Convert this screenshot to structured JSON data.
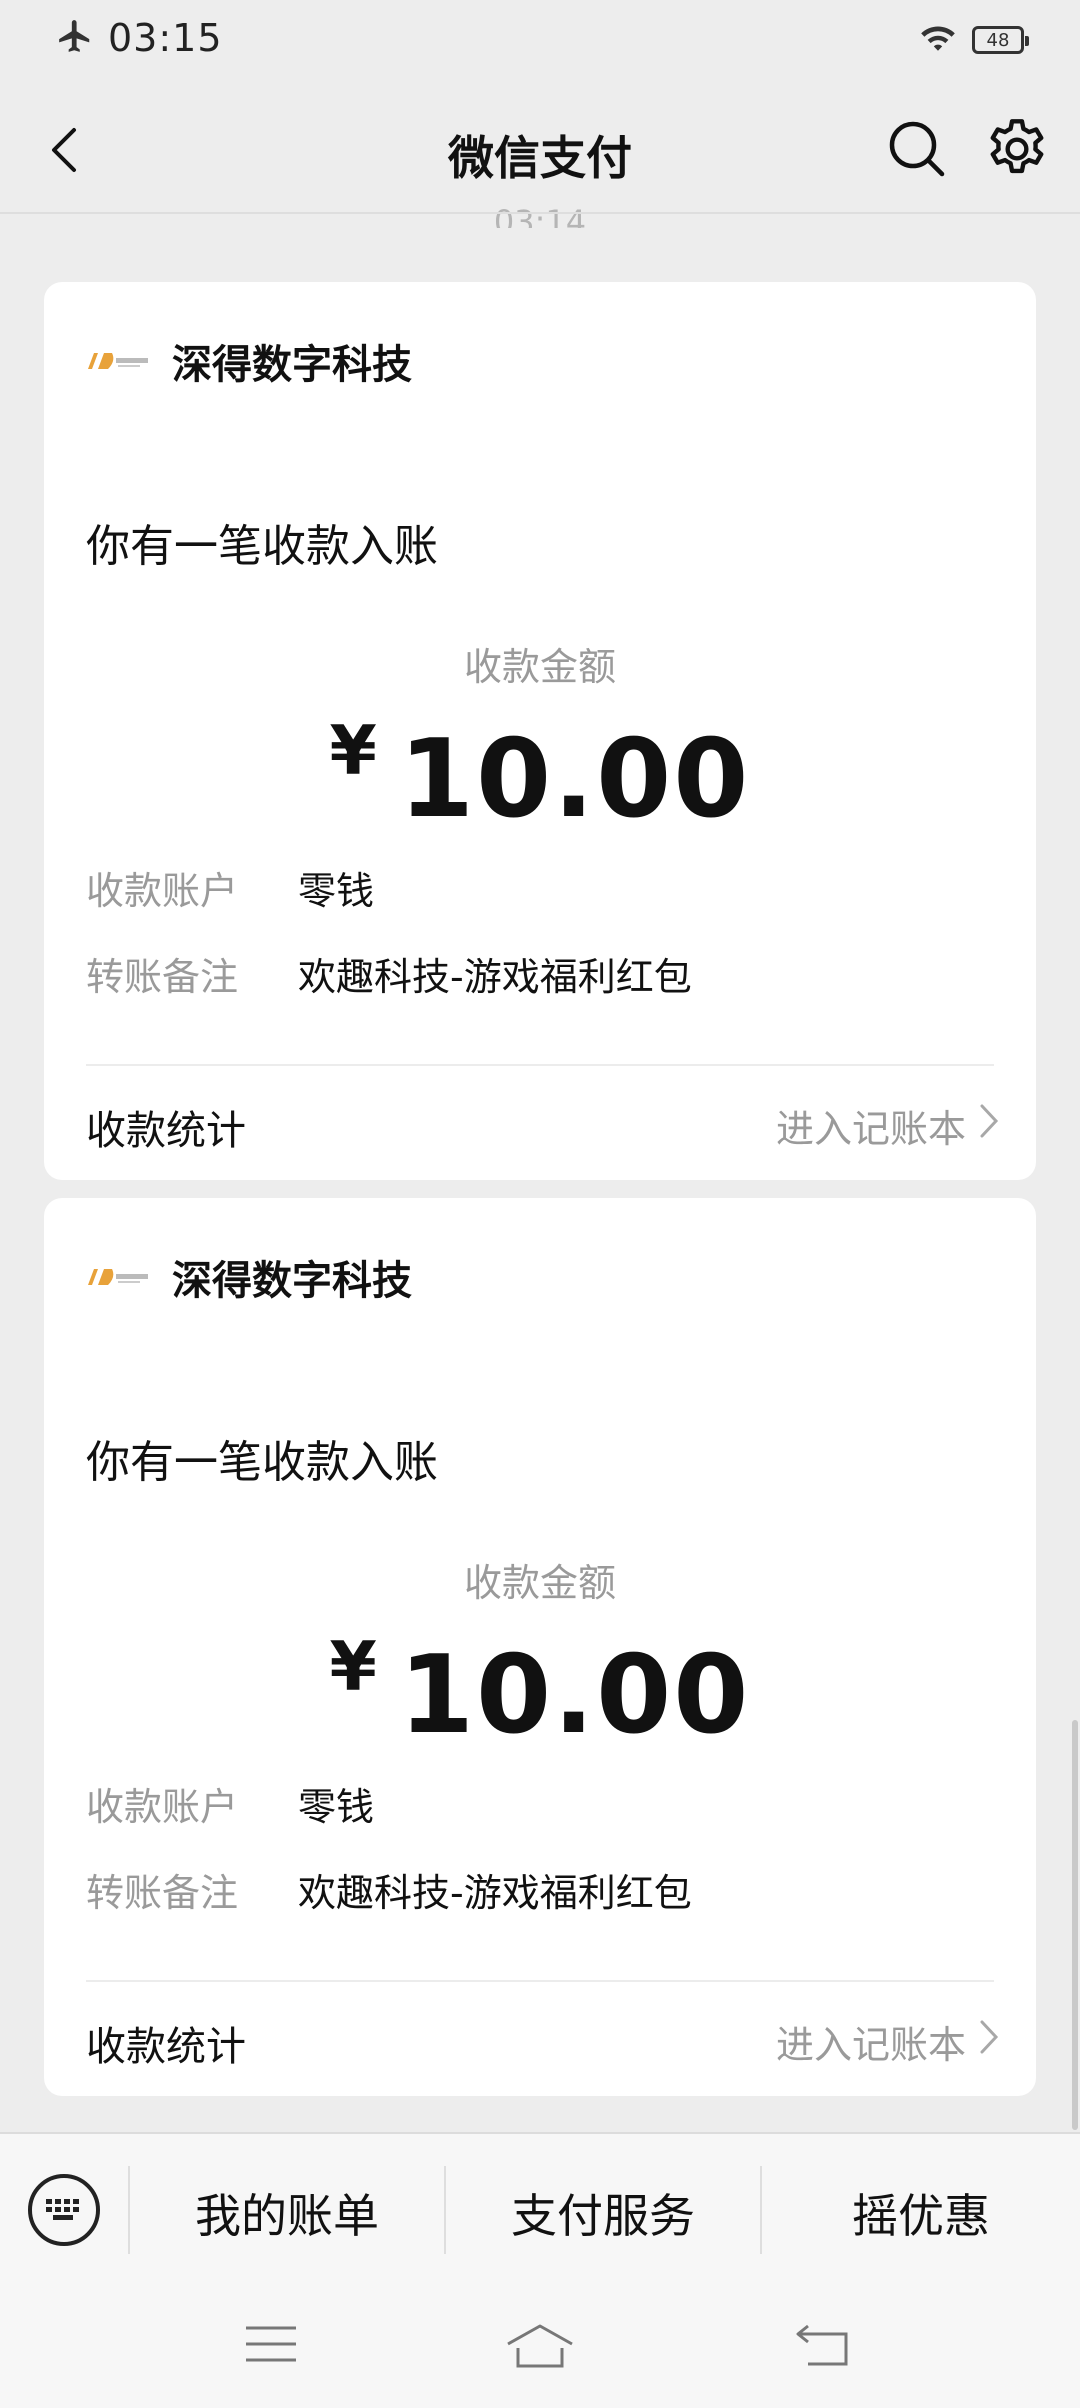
{
  "status_bar": {
    "time": "03:15",
    "battery": "48"
  },
  "nav": {
    "title": "微信支付"
  },
  "timestamp": "03:14",
  "cards": [
    {
      "merchant": "深得数字科技",
      "headline": "你有一笔收款入账",
      "amount_label": "收款金额",
      "currency": "¥",
      "amount": "10.00",
      "account_key": "收款账户",
      "account_value": "零钱",
      "remark_key": "转账备注",
      "remark_value": "欢趣科技-游戏福利红包",
      "stats_label": "收款统计",
      "stats_link": "进入记账本"
    },
    {
      "merchant": "深得数字科技",
      "headline": "你有一笔收款入账",
      "amount_label": "收款金额",
      "currency": "¥",
      "amount": "10.00",
      "account_key": "收款账户",
      "account_value": "零钱",
      "remark_key": "转账备注",
      "remark_value": "欢趣科技-游戏福利红包",
      "stats_label": "收款统计",
      "stats_link": "进入记账本"
    }
  ],
  "bottom_menu": {
    "items": [
      "我的账单",
      "支付服务",
      "摇优惠"
    ]
  },
  "colors": {
    "background": "#ededed",
    "card": "#ffffff",
    "muted_text": "#9a9a9a",
    "logo_orange": "#e8a23a"
  },
  "icons": [
    "airplane-icon",
    "wifi-icon",
    "battery-icon",
    "back-arrow-icon",
    "search-icon",
    "gear-icon",
    "merchant-logo",
    "chevron-right-icon",
    "keyboard-icon",
    "menu-lines-icon",
    "home-icon",
    "back-return-icon"
  ]
}
